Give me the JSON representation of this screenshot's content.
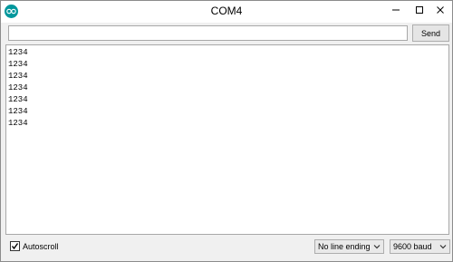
{
  "window": {
    "title": "COM4",
    "app_icon": "arduino-icon",
    "controls": [
      "minimize-icon",
      "maximize-icon",
      "close-icon"
    ]
  },
  "send_bar": {
    "input_value": "",
    "input_placeholder": "",
    "send_label": "Send"
  },
  "output": {
    "lines": [
      "1234",
      "1234",
      "1234",
      "1234",
      "1234",
      "1234",
      "1234"
    ]
  },
  "footer": {
    "autoscroll_label": "Autoscroll",
    "autoscroll_checked": true,
    "line_ending": "No line ending",
    "baud_rate": "9600 baud"
  },
  "colors": {
    "accent": "#00979c",
    "window_bg": "#f0f0f0",
    "text": "#000000"
  }
}
